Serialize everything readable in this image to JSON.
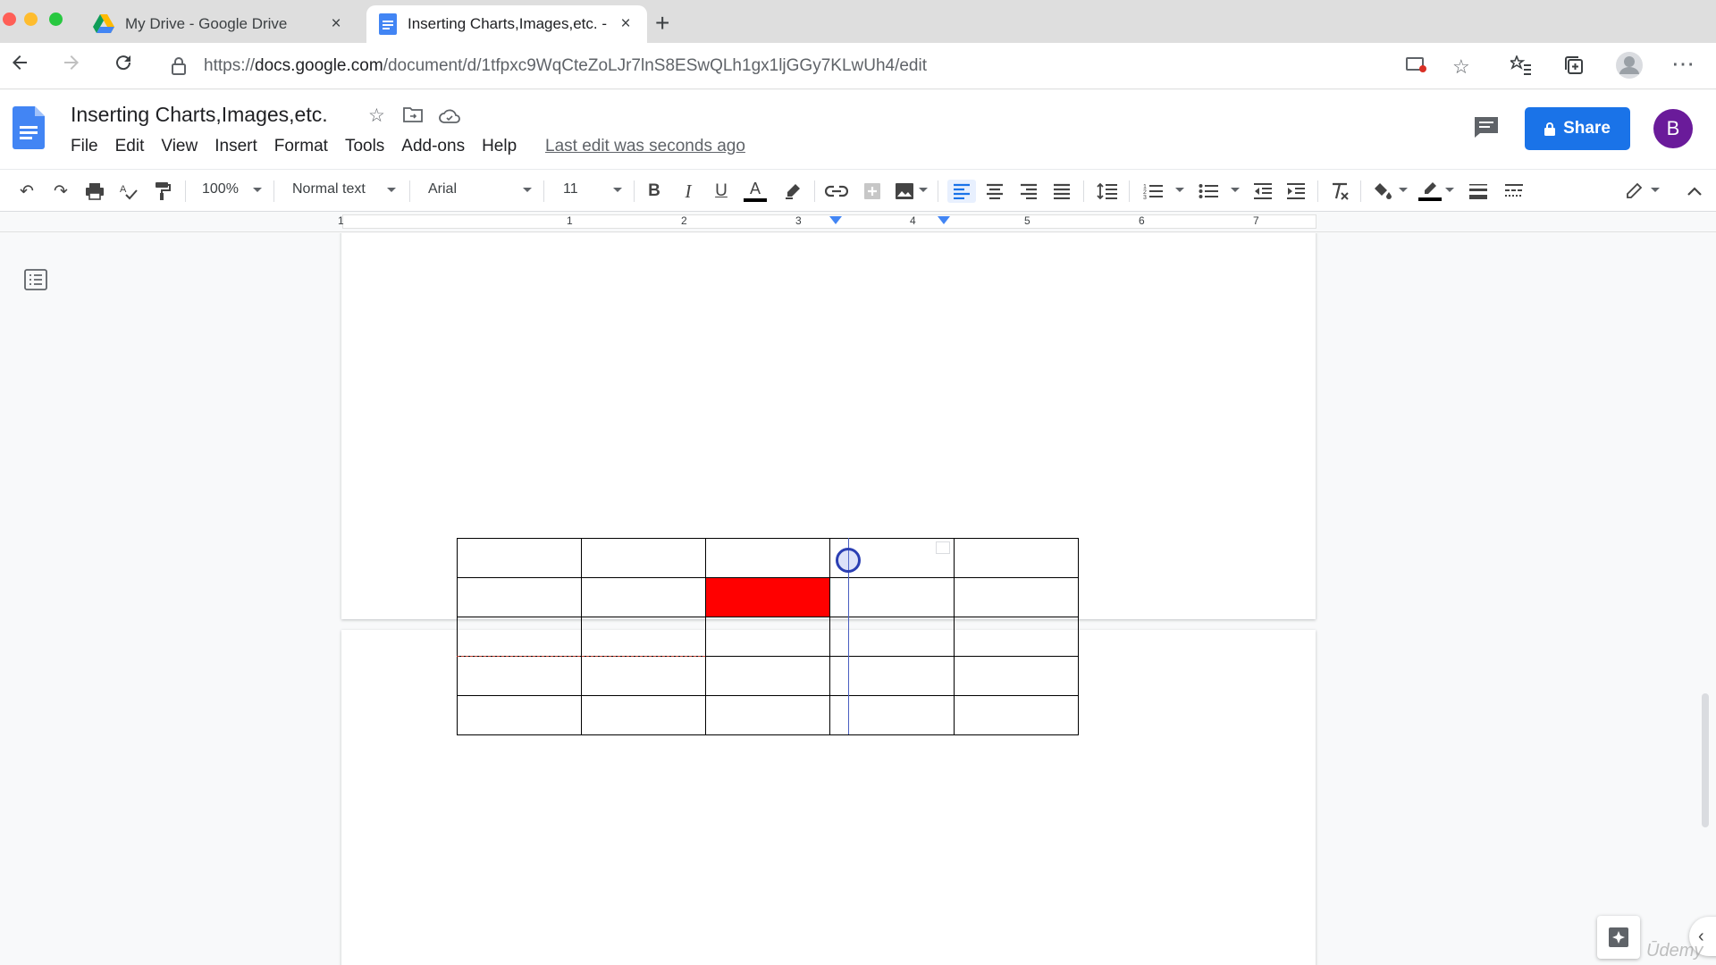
{
  "colors": {
    "accent_blue": "#1a73e8",
    "avatar_purple": "#6a1b9a",
    "highlighted_cell": "#ff0000",
    "traffic_red": "#ff5f57",
    "traffic_yellow": "#febc2e",
    "traffic_green": "#28c840"
  },
  "browser": {
    "tabs": [
      {
        "title": "My Drive - Google Drive",
        "icon": "google-drive-icon",
        "close": "×"
      },
      {
        "title": "Inserting Charts,Images,etc. -",
        "icon": "google-docs-icon",
        "close": "×"
      }
    ],
    "new_tab": "+",
    "url_scheme": "https://",
    "url_host": "docs.google.com",
    "url_path": "/document/d/1tfpxc9WqCteZoLJr7lnS8ESwQLh1gx1ljGGy7KLwUh4/edit"
  },
  "docs": {
    "title": "Inserting Charts,Images,etc.",
    "menu": [
      "File",
      "Edit",
      "View",
      "Insert",
      "Format",
      "Tools",
      "Add-ons",
      "Help"
    ],
    "last_edit": "Last edit was seconds ago",
    "share_label": "Share",
    "avatar_letter": "B"
  },
  "toolbar": {
    "zoom": "100%",
    "style": "Normal text",
    "font": "Arial",
    "font_size": "11",
    "bold": "B",
    "italic": "I",
    "underline": "U",
    "text_color": "A"
  },
  "ruler": {
    "numbers": [
      "1",
      "1",
      "2",
      "3",
      "4",
      "5",
      "6",
      "7"
    ]
  },
  "table": {
    "rows": 5,
    "cols": 5,
    "filled_cell": {
      "row": 1,
      "col": 2
    }
  },
  "watermark": "Ūdemy"
}
